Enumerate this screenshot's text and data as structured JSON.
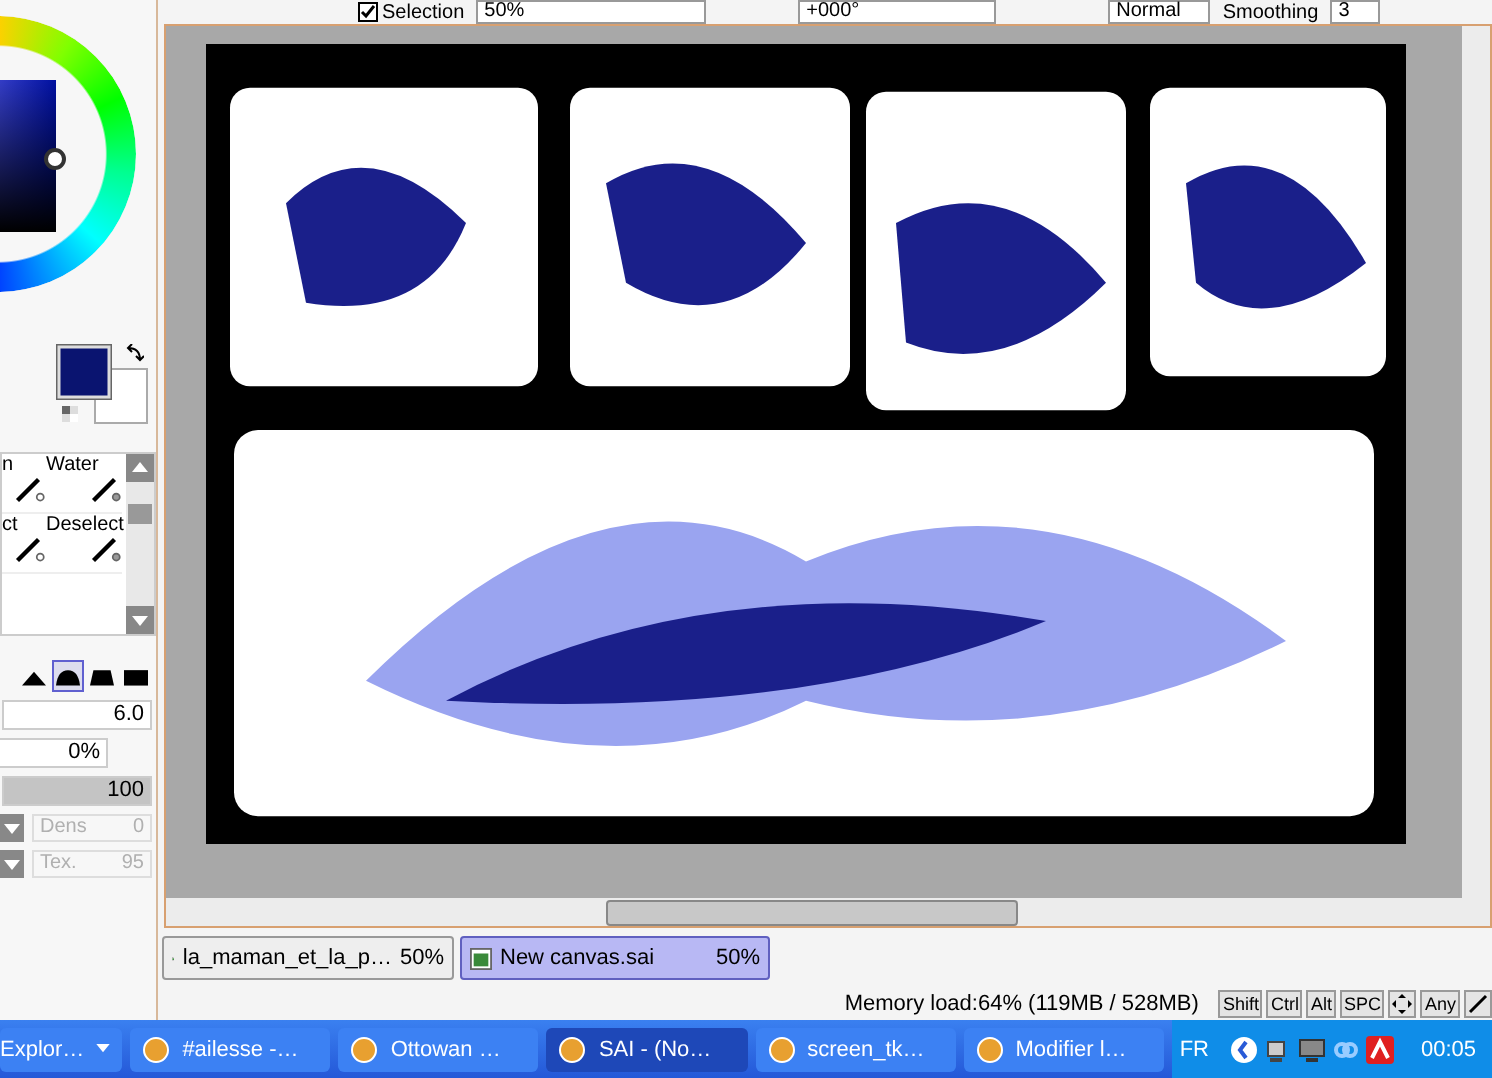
{
  "toolbar": {
    "selection": {
      "label": "Selection",
      "checked": true
    },
    "zoom": "50%",
    "angle": "+000°",
    "blend_mode": "Normal",
    "smoothing_label": "Smoothing",
    "smoothing": "3"
  },
  "tools": [
    {
      "label": "n"
    },
    {
      "label": "Water"
    },
    {
      "label": "ct"
    },
    {
      "label": "Deselect"
    }
  ],
  "brush_shapes": [
    {
      "selected": false
    },
    {
      "selected": true
    },
    {
      "selected": false
    },
    {
      "selected": false
    }
  ],
  "brush_size": "6.0",
  "min_size": "0%",
  "density": {
    "value": "100",
    "level": 1.0
  },
  "dens": {
    "label": "Dens",
    "value": "0",
    "disabled": true
  },
  "tex": {
    "label": "Tex.",
    "value": "95",
    "disabled": true
  },
  "document_tabs": [
    {
      "title": "la_maman_et_la_p…",
      "zoom": "50%",
      "selected": false
    },
    {
      "title": "New canvas.sai",
      "zoom": "50%",
      "selected": true
    }
  ],
  "status": {
    "memory": "Memory load:64% (119MB / 528MB)",
    "keys": [
      "Shift",
      "Ctrl",
      "Alt",
      "SPC"
    ],
    "any": "Any"
  },
  "taskbar": {
    "items": [
      {
        "label": "Explor…",
        "selected": false
      },
      {
        "label": "#ailesse -…",
        "selected": false
      },
      {
        "label": "Ottowan …",
        "selected": false
      },
      {
        "label": "SAI - (No…",
        "selected": true
      },
      {
        "label": "screen_tk…",
        "selected": false
      },
      {
        "label": "Modifier l…",
        "selected": false
      }
    ],
    "language": "FR",
    "clock": "00:05"
  }
}
